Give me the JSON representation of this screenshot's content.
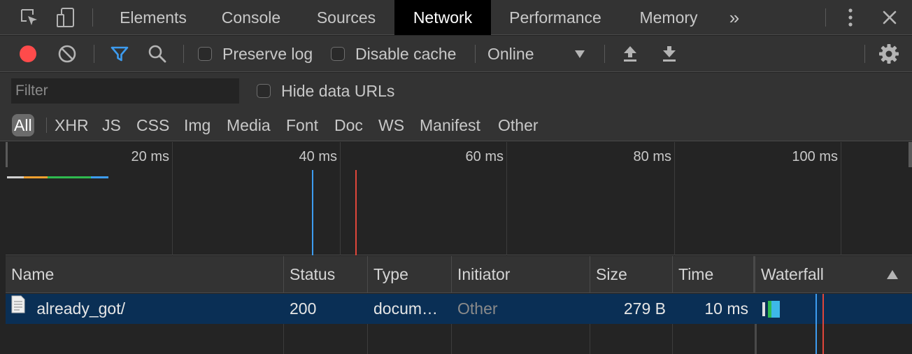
{
  "tabs": {
    "elements": "Elements",
    "console": "Console",
    "sources": "Sources",
    "network": "Network",
    "performance": "Performance",
    "memory": "Memory",
    "more": "»"
  },
  "toolbar": {
    "preserve_log": "Preserve log",
    "disable_cache": "Disable cache",
    "throttling": "Online"
  },
  "filter": {
    "placeholder": "Filter",
    "hide_data_urls": "Hide data URLs"
  },
  "types": [
    "All",
    "XHR",
    "JS",
    "CSS",
    "Img",
    "Media",
    "Font",
    "Doc",
    "WS",
    "Manifest",
    "Other"
  ],
  "overview": {
    "ticks": [
      "20 ms",
      "40 ms",
      "60 ms",
      "80 ms",
      "100 ms"
    ]
  },
  "table": {
    "headers": {
      "name": "Name",
      "status": "Status",
      "type": "Type",
      "initiator": "Initiator",
      "size": "Size",
      "time": "Time",
      "waterfall": "Waterfall"
    },
    "rows": [
      {
        "name": "already_got/",
        "status": "200",
        "type": "docum…",
        "initiator": "Other",
        "size": "279 B",
        "time": "10 ms"
      }
    ]
  },
  "colors": {
    "record": "#ff4b4b",
    "filter_active": "#3d9cf0",
    "selected_row": "#0a2f55",
    "dom_content_loaded": "#3d9cf0",
    "load": "#e0463a"
  }
}
